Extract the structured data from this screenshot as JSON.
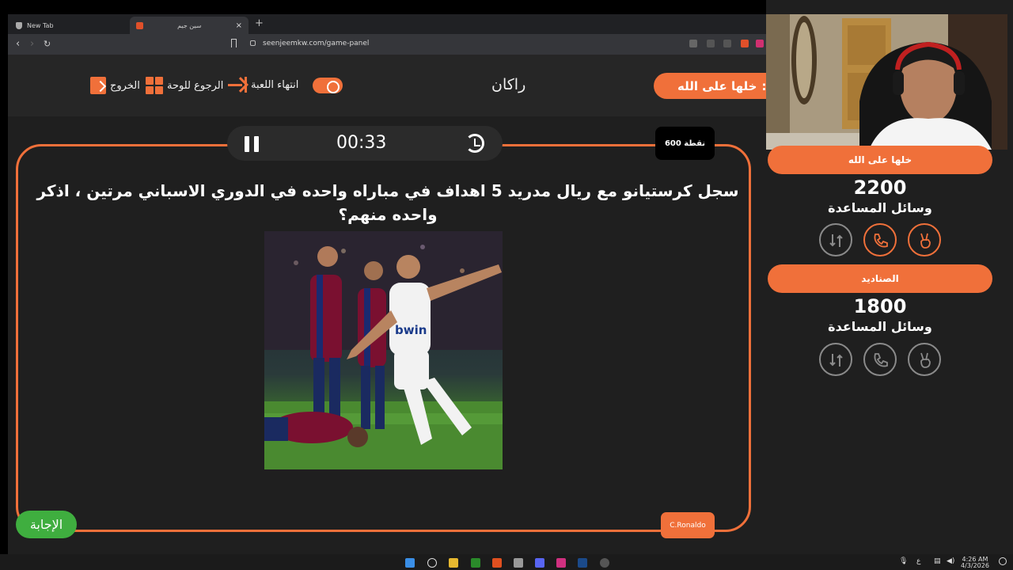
{
  "browser": {
    "tabs": [
      {
        "label": "New Tab",
        "active": false
      },
      {
        "label": "سين جيم",
        "active": true
      }
    ],
    "url": "seenjeemkw.com/game-panel"
  },
  "topbar": {
    "exit_label": "الخروج",
    "back_to_board_label": "الرجوع للوحة",
    "end_game_label": "انتهاء اللعبة",
    "current_team_name": "راكان",
    "turn_prefix": ":",
    "turn_team_label": "خلها على الله"
  },
  "game": {
    "points_badge": "600 نقطة",
    "timer": "00:33",
    "question": "سجل كرستيانو مع ريال مدريد 5 اهداف في مباراه واحده في الدوري الاسباني مرتين ، اذكر واحده منهم؟",
    "image_jersey_text": "bwin",
    "answer_button": "الإجابة",
    "answer_pill": "C.Ronaldo"
  },
  "teams": [
    {
      "name": "خلها على الله",
      "score": "2200",
      "help_label": "وسائل المساعدة",
      "helps": [
        {
          "icon": "swap-icon",
          "active": false
        },
        {
          "icon": "phone-icon",
          "active": true
        },
        {
          "icon": "victory-hand-icon",
          "active": true
        }
      ]
    },
    {
      "name": "الصناديد",
      "score": "1800",
      "help_label": "وسائل المساعدة",
      "helps": [
        {
          "icon": "swap-icon",
          "active": false
        },
        {
          "icon": "phone-icon",
          "active": false
        },
        {
          "icon": "victory-hand-icon",
          "active": false
        }
      ]
    }
  ],
  "taskbar": {
    "time": "4:26 AM",
    "date": "4/3/2026",
    "lang": "ع"
  },
  "colors": {
    "accent": "#f0703a",
    "answer_green": "#3fae3f",
    "page_bg": "#1f1f1f"
  }
}
